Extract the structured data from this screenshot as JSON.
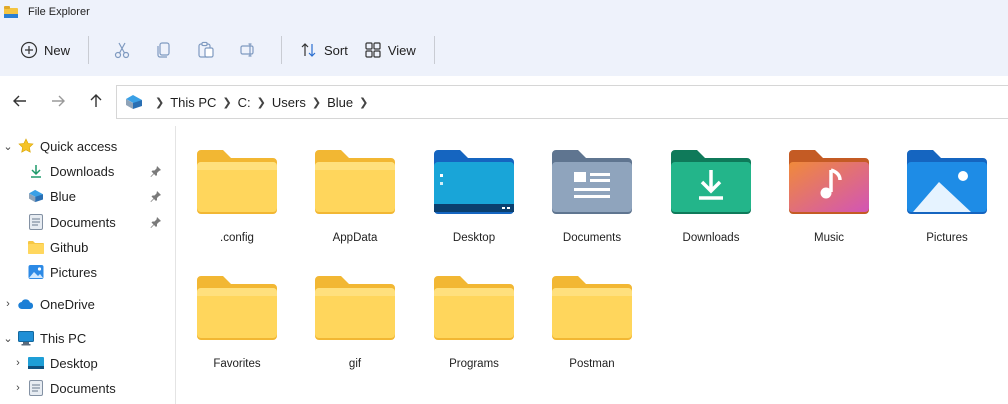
{
  "window": {
    "title": "File Explorer"
  },
  "toolbar": {
    "new_label": "New",
    "sort_label": "Sort",
    "view_label": "View",
    "icons": [
      "cut-icon",
      "copy-icon",
      "paste-icon",
      "rename-icon"
    ]
  },
  "address": {
    "crumbs": [
      "This PC",
      "C:",
      "Users",
      "Blue"
    ]
  },
  "sidebar": {
    "quick_access": "Quick access",
    "quick_items": [
      {
        "label": "Downloads",
        "icon": "download-arrow-icon",
        "pinned": true
      },
      {
        "label": "Blue",
        "icon": "user-folder-icon",
        "pinned": true
      },
      {
        "label": "Documents",
        "icon": "documents-icon",
        "pinned": true
      },
      {
        "label": "Github",
        "icon": "folder-icon",
        "pinned": false
      },
      {
        "label": "Pictures",
        "icon": "pictures-icon",
        "pinned": false
      }
    ],
    "onedrive": "OneDrive",
    "this_pc": "This PC",
    "pc_items": [
      {
        "label": "Desktop",
        "icon": "desktop-icon"
      },
      {
        "label": "Documents",
        "icon": "documents-icon"
      }
    ]
  },
  "folders": [
    {
      "name": ".config",
      "kind": "plain"
    },
    {
      "name": "AppData",
      "kind": "plain"
    },
    {
      "name": "Desktop",
      "kind": "desktop"
    },
    {
      "name": "Documents",
      "kind": "documents"
    },
    {
      "name": "Downloads",
      "kind": "downloads"
    },
    {
      "name": "Music",
      "kind": "music"
    },
    {
      "name": "Pictures",
      "kind": "pictures"
    },
    {
      "name": "Favorites",
      "kind": "plain"
    },
    {
      "name": "gif",
      "kind": "plain"
    },
    {
      "name": "Programs",
      "kind": "plain"
    },
    {
      "name": "Postman",
      "kind": "plain"
    }
  ]
}
